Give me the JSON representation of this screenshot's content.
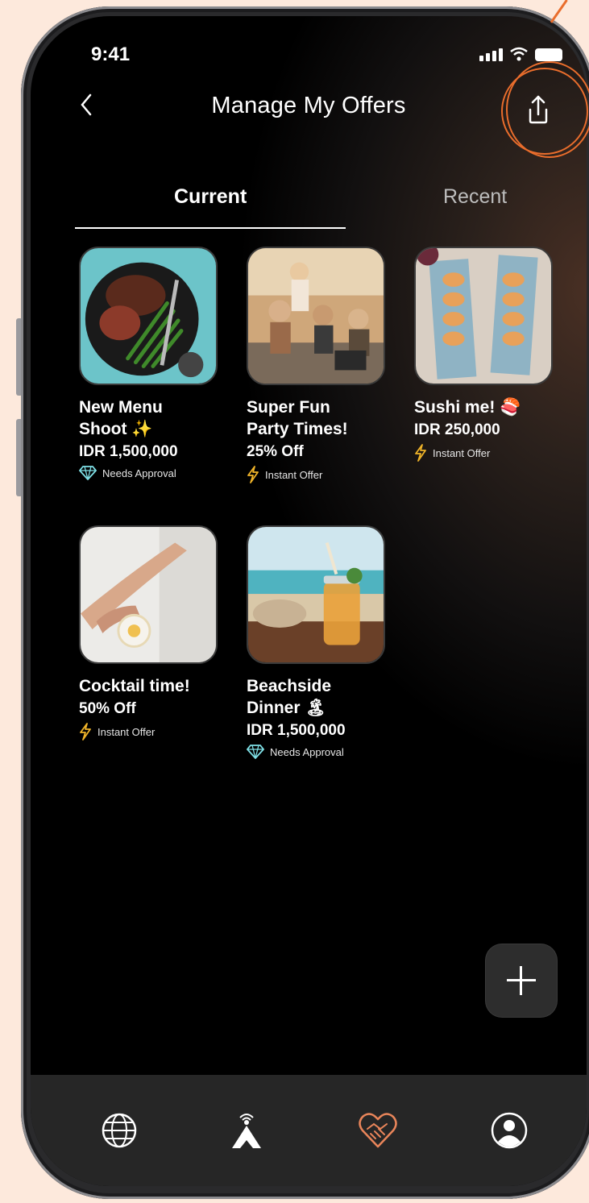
{
  "status": {
    "time": "9:41"
  },
  "header": {
    "title": "Manage My Offers",
    "back_icon": "chevron-left-icon",
    "share_icon": "share-icon"
  },
  "tabs": [
    {
      "label": "Current",
      "active": true
    },
    {
      "label": "Recent",
      "active": false
    }
  ],
  "offers": [
    {
      "title_line1": "New Menu",
      "title_line2": "Shoot ✨",
      "price": "IDR 1,500,000",
      "badge": "Needs Approval",
      "badge_icon": "diamond-icon"
    },
    {
      "title_line1": "Super Fun",
      "title_line2": "Party Times!",
      "price": "25% Off",
      "badge": "Instant Offer",
      "badge_icon": "lightning-icon"
    },
    {
      "title_line1": "Sushi me! 🍣",
      "title_line2": "",
      "price": "IDR 250,000",
      "badge": "Instant Offer",
      "badge_icon": "lightning-icon"
    },
    {
      "title_line1": "Cocktail time!",
      "title_line2": "",
      "price": "50% Off",
      "badge": "Instant Offer",
      "badge_icon": "lightning-icon"
    },
    {
      "title_line1": "Beachside",
      "title_line2": "Dinner 🏝",
      "price": "IDR 1,500,000",
      "badge": "Needs Approval",
      "badge_icon": "diamond-icon"
    }
  ],
  "fab": {
    "icon": "plus-icon"
  },
  "bottom_nav": [
    {
      "icon": "globe-icon",
      "active": false
    },
    {
      "icon": "broadcast-tower-icon",
      "active": false
    },
    {
      "icon": "handshake-heart-icon",
      "active": true
    },
    {
      "icon": "profile-icon",
      "active": false
    }
  ],
  "colors": {
    "accent": "#e9855a",
    "annotation": "#e96d2c",
    "lightning": "#f0b429",
    "diamond": "#7fe0e6"
  }
}
